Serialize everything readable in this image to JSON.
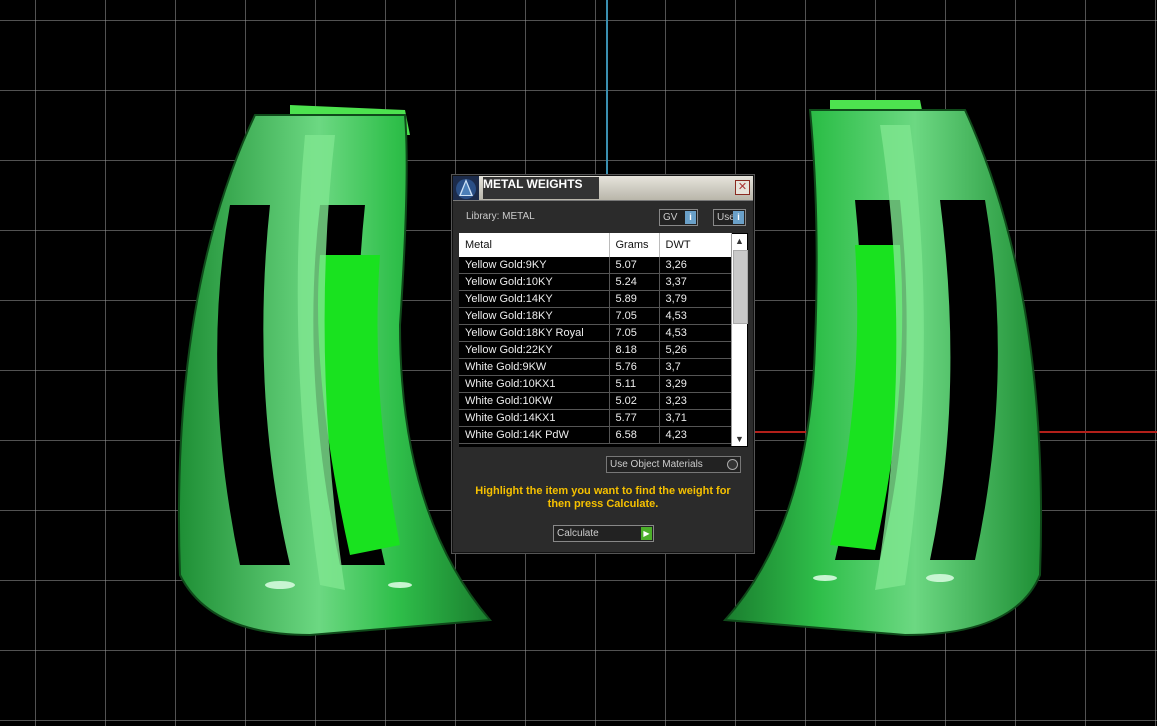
{
  "dialog": {
    "title": "METAL WEIGHTS",
    "close_glyph": "✕",
    "library_label": "Library: METAL",
    "gv_label": "GV",
    "user_label": "User",
    "info_glyph": "i",
    "columns": [
      "Metal",
      "Grams",
      "DWT"
    ],
    "rows": [
      {
        "metal": "Yellow Gold:9KY",
        "grams": "5.07",
        "dwt": "3,26"
      },
      {
        "metal": "Yellow Gold:10KY",
        "grams": "5.24",
        "dwt": "3,37"
      },
      {
        "metal": "Yellow Gold:14KY",
        "grams": "5.89",
        "dwt": "3,79"
      },
      {
        "metal": "Yellow Gold:18KY",
        "grams": "7.05",
        "dwt": "4,53"
      },
      {
        "metal": "Yellow Gold:18KY Royal",
        "grams": "7.05",
        "dwt": "4,53"
      },
      {
        "metal": "Yellow Gold:22KY",
        "grams": "8.18",
        "dwt": "5,26"
      },
      {
        "metal": "White Gold:9KW",
        "grams": "5.76",
        "dwt": "3,7"
      },
      {
        "metal": "White Gold:10KX1",
        "grams": "5.11",
        "dwt": "3,29"
      },
      {
        "metal": "White Gold:10KW",
        "grams": "5.02",
        "dwt": "3,23"
      },
      {
        "metal": "White Gold:14KX1",
        "grams": "5.77",
        "dwt": "3,71"
      },
      {
        "metal": "White Gold:14K PdW",
        "grams": "6.58",
        "dwt": "4,23"
      }
    ],
    "use_object_materials": "Use Object Materials",
    "hint": "Highlight the item you want to find the weight for then press Calculate.",
    "calculate_label": "Calculate",
    "scroll_up_glyph": "▲",
    "scroll_down_glyph": "▼",
    "calc_arrow_glyph": "▶"
  },
  "colors": {
    "ring_green": "#2fbf4a",
    "ring_bright": "#19e21f",
    "hint_yellow": "#f5c000",
    "viewport_bg": "#000000",
    "grid": "#969696"
  }
}
